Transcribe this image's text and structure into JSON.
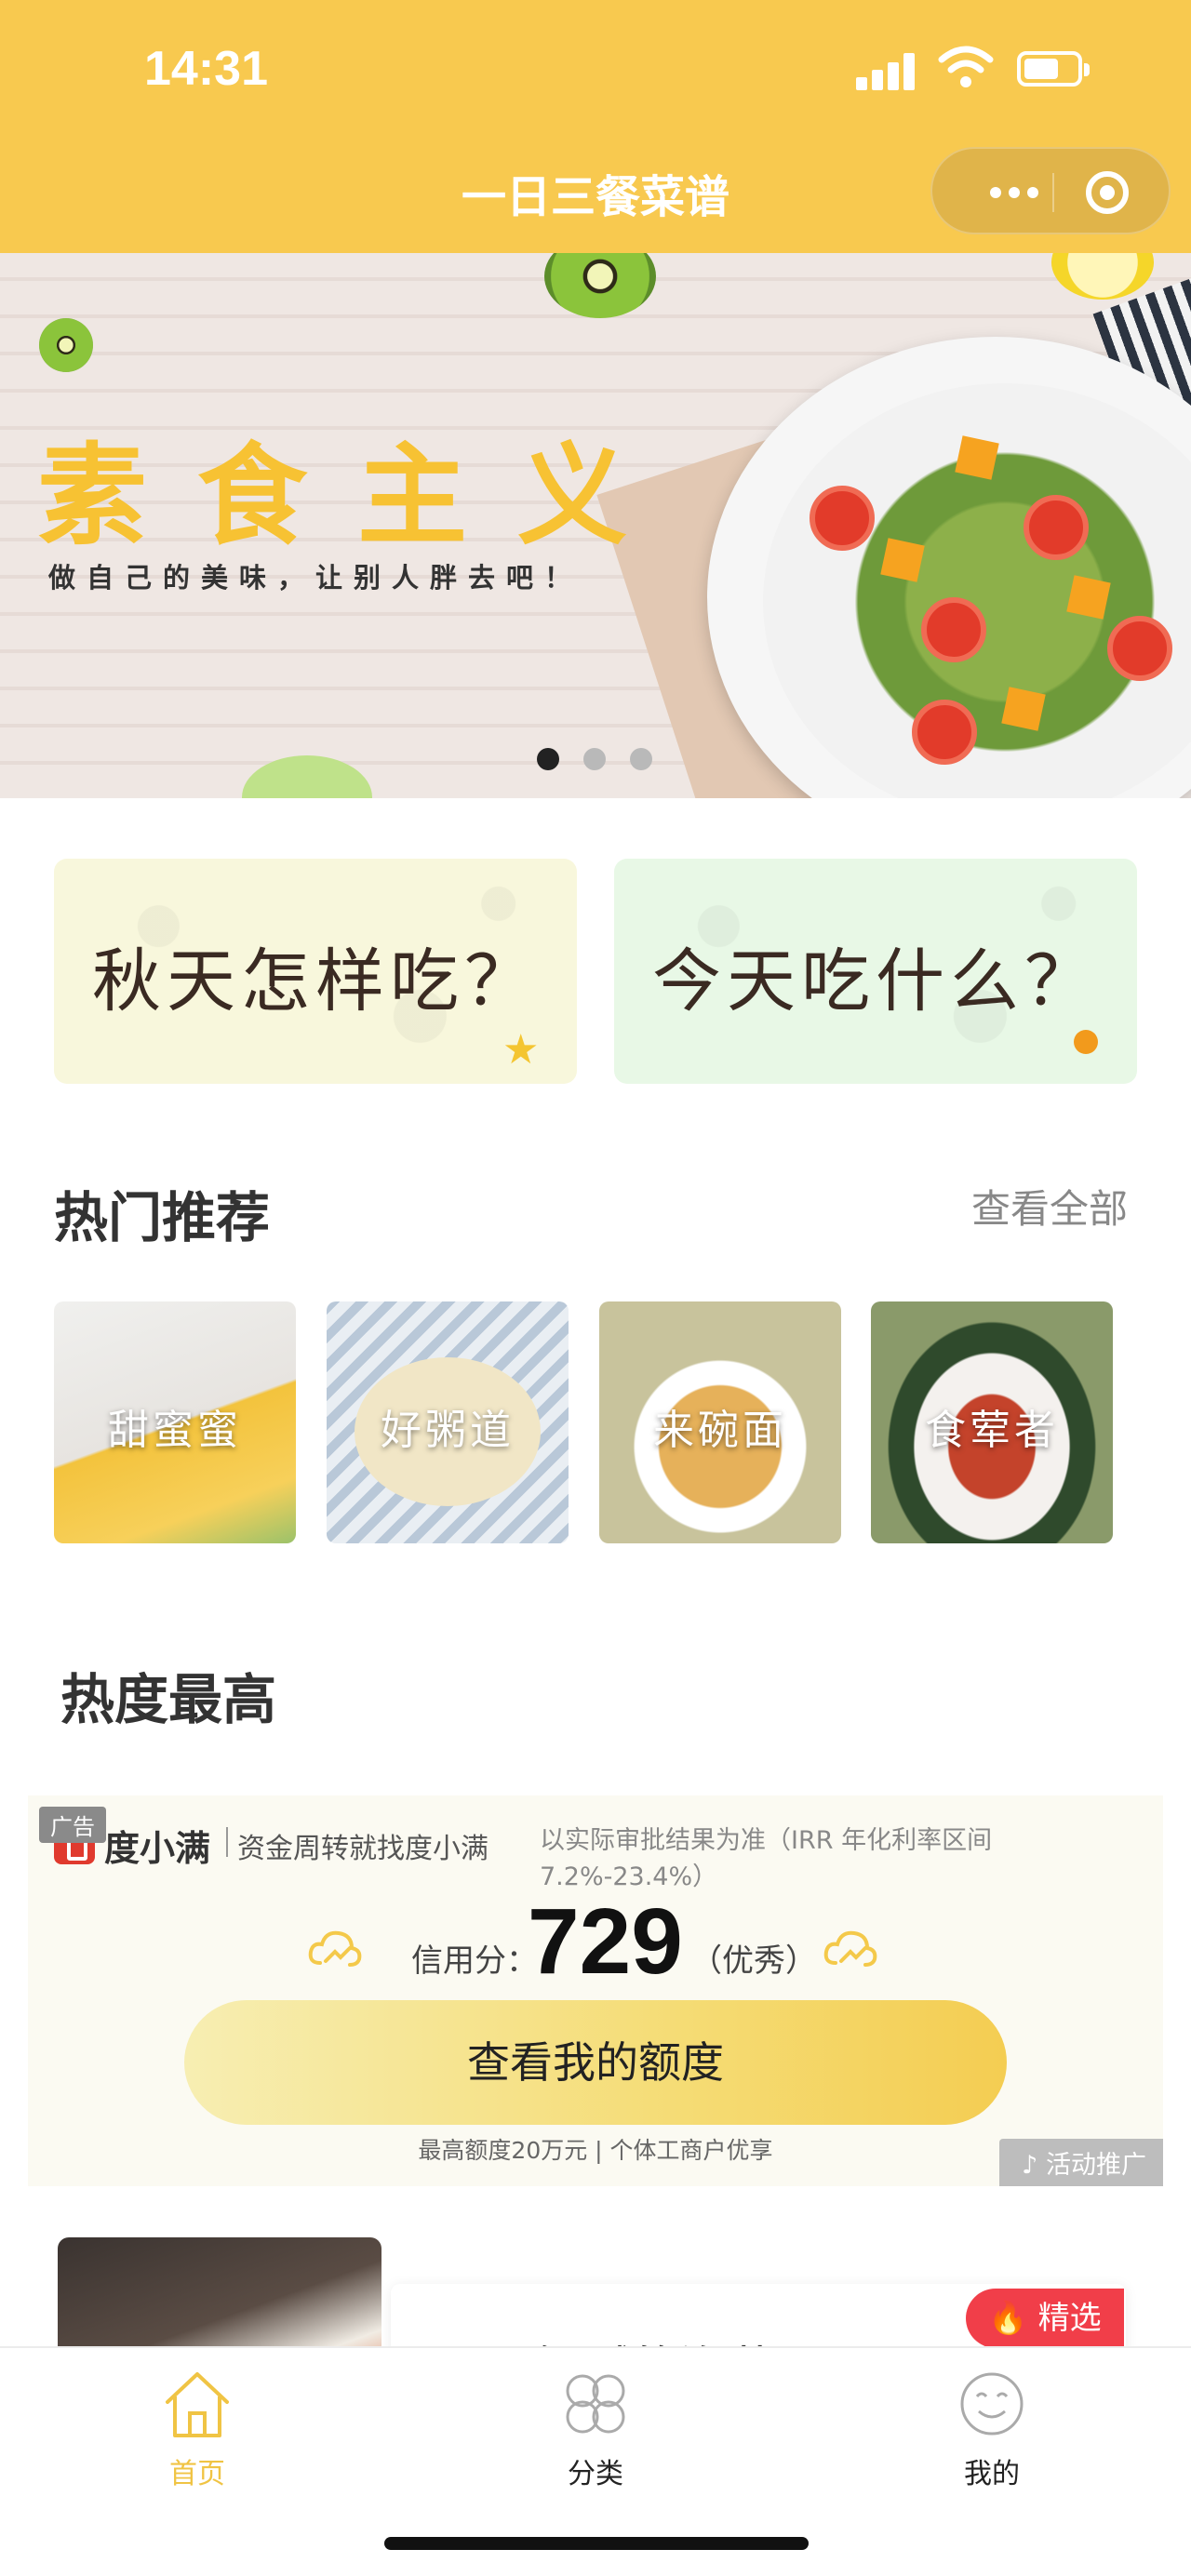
{
  "status_bar": {
    "time": "14:31"
  },
  "nav": {
    "title": "一日三餐菜谱"
  },
  "banner": {
    "title": "素食主义",
    "subtitle": "做自己的美味，让别人胖去吧！",
    "slide_count": 3,
    "active_slide": 1
  },
  "promos": [
    {
      "label": "秋天怎样吃？"
    },
    {
      "label": "今天吃什么？"
    }
  ],
  "hot_recommend": {
    "title": "热门推荐",
    "see_all": "查看全部",
    "items": [
      {
        "label": "甜蜜蜜"
      },
      {
        "label": "好粥道"
      },
      {
        "label": "来碗面"
      },
      {
        "label": "食荤者"
      }
    ]
  },
  "hottest": {
    "title": "热度最高"
  },
  "ad": {
    "tag": "广告",
    "brand": "度小满",
    "slogan": "资金周转就找度小满",
    "note": "以实际审批结果为准（IRR 年化利率区间 7.2%-23.4%）",
    "score_label": "信用分：",
    "score": "729",
    "grade": "（优秀）",
    "button": "查看我的额度",
    "footer": "最高额度20万元 | 个体工商户优享",
    "promo_tag": "♪ 活动推广"
  },
  "hot_item": {
    "title": "开胃解腻的泡菜",
    "badge": "精选"
  },
  "tabbar": {
    "home": "首页",
    "category": "分类",
    "me": "我的"
  },
  "colors": {
    "brand": "#f8c94f",
    "active_tab": "#f0c444",
    "badge": "#f13e49"
  }
}
